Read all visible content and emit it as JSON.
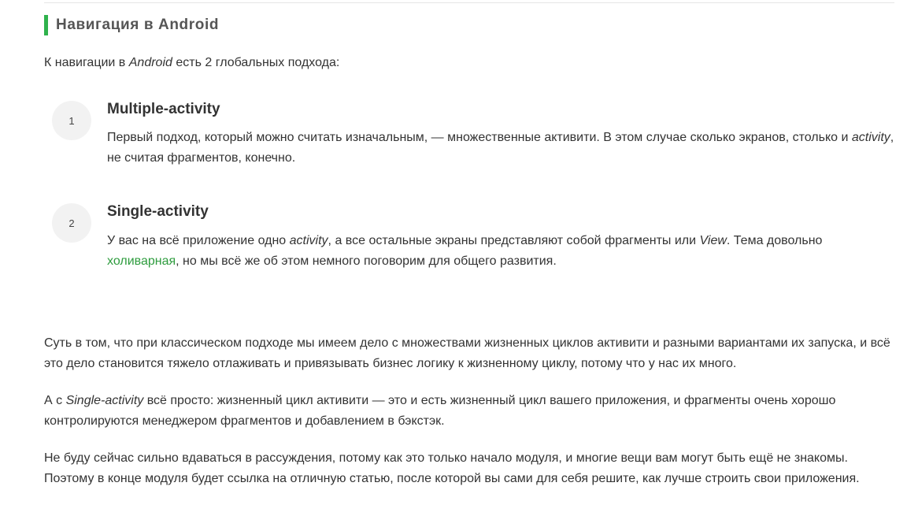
{
  "heading": {
    "title": "Навигация в Android",
    "accent_color": "#2fb24c"
  },
  "intro": {
    "before": "К навигации в ",
    "em": "Android",
    "after": " есть 2 глобальных подхода:"
  },
  "approaches": [
    {
      "number": "1",
      "title": "Multiple-activity",
      "desc_before": "Первый подход, который можно считать изначальным, — множественные активити. В этом случае сколько экранов, столько и ",
      "desc_em": "activity",
      "desc_after": ", не считая фрагментов, конечно."
    },
    {
      "number": "2",
      "title": "Single-activity",
      "desc_part1": "У вас на всё приложение одно ",
      "desc_em1": "activity",
      "desc_part2": ", а все остальные экраны представляют собой фрагменты или ",
      "desc_em2": "View",
      "desc_part3": ". Тема довольно ",
      "link_text": "холиварная",
      "link_color": "#2e9c3e",
      "desc_part4": ", но мы всё же об этом немного поговорим для общего развития."
    }
  ],
  "paragraphs": {
    "p1": "Суть в том, что при классическом подходе мы имеем дело с множествами жизненных циклов активити и разными вариантами их запуска, и всё это дело становится тяжело отлаживать и привязывать бизнес логику к жизненному циклу, потому что у нас их много.",
    "p2_before": "А с ",
    "p2_em": "Single-activity",
    "p2_after": " всё просто: жизненный цикл активити — это и есть жизненный цикл вашего приложения, и фрагменты очень хорошо контролируются менеджером фрагментов и добавлением в бэкстэк.",
    "p3": "Не буду сейчас сильно вдаваться в рассуждения, потому как это только начало модуля, и многие вещи вам могут быть ещё не знакомы. Поэтому в конце модуля будет ссылка на отличную статью, после которой вы сами для себя решите, как лучше строить свои приложения."
  }
}
